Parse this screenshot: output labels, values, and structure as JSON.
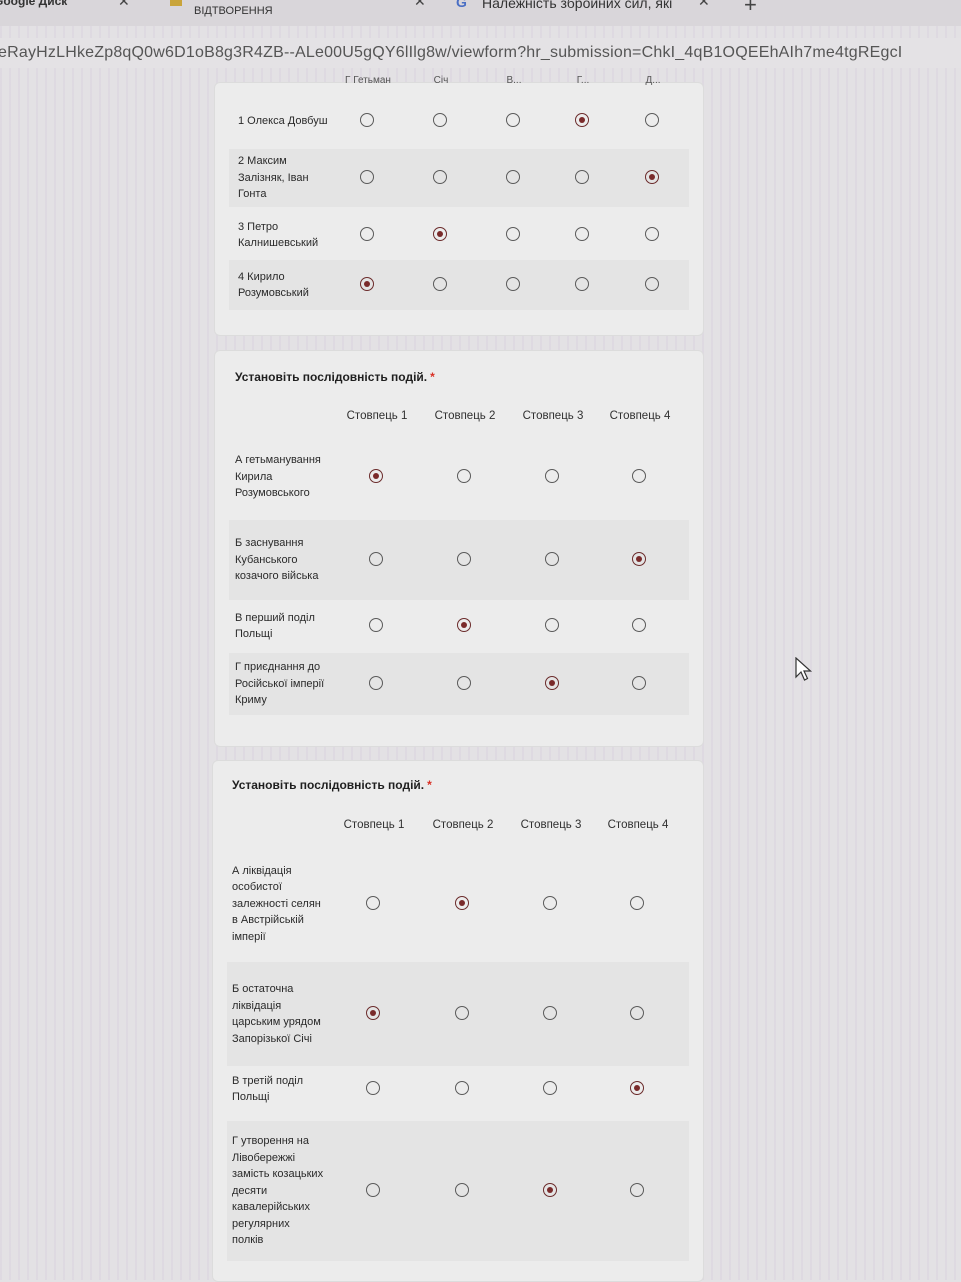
{
  "browser": {
    "tabs": [
      {
        "label": "Google Диск"
      },
      {
        "label": "ВІДТВОРЕННЯ"
      },
      {
        "label": "Належність збройних сил, які"
      }
    ],
    "url": "eRayHzLHkeZp8qQ0w6D1oB8g3R4ZB--ALe00U5gQY6lIlg8w/viewform?hr_submission=ChkI_4qB1OQEEhAIh7me4tgREgcI"
  },
  "form": {
    "question1": {
      "columns": [
        "Г Гетьман",
        "Січ",
        "В...",
        "Г...",
        "Д..."
      ],
      "rows": [
        {
          "label": "1 Олекса Довбуш",
          "selected": 3
        },
        {
          "label": "2 Максим Залізняк, Іван Гонта",
          "selected": 4
        },
        {
          "label": "3 Петро Калнишевський",
          "selected": 1
        },
        {
          "label": "4 Кирило Розумовський",
          "selected": 0
        }
      ]
    },
    "question2": {
      "title": "Установіть послідовність подій.",
      "required_mark": "*",
      "columns": [
        "Стовпець 1",
        "Стовпець 2",
        "Стовпець 3",
        "Стовпець 4"
      ],
      "rows": [
        {
          "label": "А гетьманування Кирила Розумовського",
          "selected": 0
        },
        {
          "label": "Б заснування Кубанського козачого війська",
          "selected": 3
        },
        {
          "label": "В перший поділ Польщі",
          "selected": 1
        },
        {
          "label": "Г приєднання до Російської імперії Криму",
          "selected": 2
        }
      ]
    },
    "question3": {
      "title": "Установіть послідовність подій.",
      "required_mark": "*",
      "columns": [
        "Стовпець 1",
        "Стовпець 2",
        "Стовпець 3",
        "Стовпець 4"
      ],
      "rows": [
        {
          "label": "А ліквідація особистої залежності селян в Австрійській імперії",
          "selected": 1
        },
        {
          "label": "Б остаточна ліквідація царським урядом Запорізької Січі",
          "selected": 0
        },
        {
          "label": "В третій поділ Польщі",
          "selected": 3
        },
        {
          "label": "Г утворення на Лівобережжі замість козацьких десяти кавалерійських регулярних полків",
          "selected": 2
        }
      ]
    }
  }
}
